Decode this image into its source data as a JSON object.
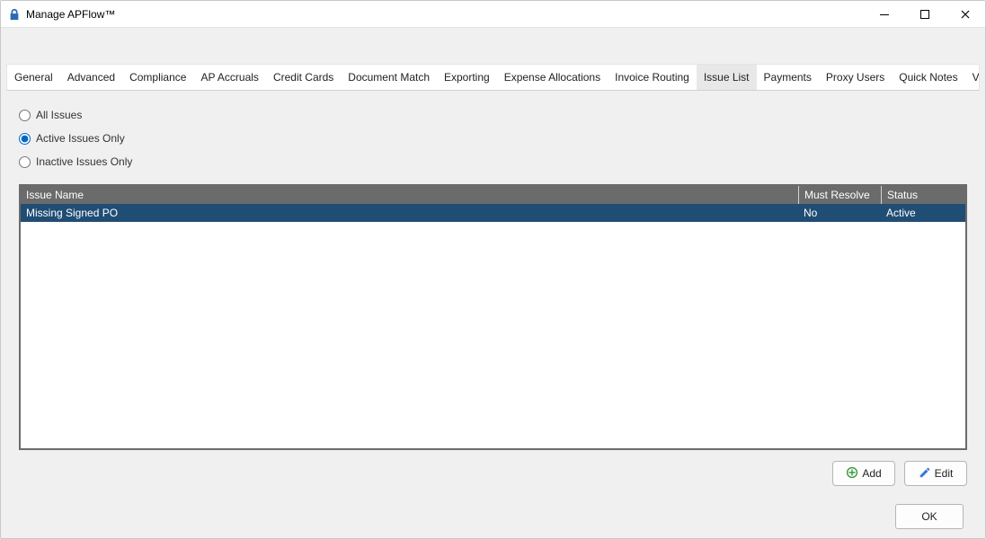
{
  "window": {
    "title": "Manage APFlow™"
  },
  "tabs": [
    {
      "label": "General"
    },
    {
      "label": "Advanced"
    },
    {
      "label": "Compliance"
    },
    {
      "label": "AP Accruals"
    },
    {
      "label": "Credit Cards"
    },
    {
      "label": "Document Match"
    },
    {
      "label": "Exporting"
    },
    {
      "label": "Expense Allocations"
    },
    {
      "label": "Invoice Routing"
    },
    {
      "label": "Issue List",
      "active": true
    },
    {
      "label": "Payments"
    },
    {
      "label": "Proxy Users"
    },
    {
      "label": "Quick Notes"
    },
    {
      "label": "Validation"
    }
  ],
  "filters": {
    "selected": "active",
    "all_label": "All Issues",
    "active_label": "Active Issues Only",
    "inactive_label": "Inactive Issues Only"
  },
  "grid": {
    "columns": {
      "name": "Issue Name",
      "resolve": "Must Resolve",
      "status": "Status"
    },
    "rows": [
      {
        "name": "Missing Signed PO",
        "resolve": "No",
        "status": "Active",
        "selected": true
      }
    ]
  },
  "buttons": {
    "add": "Add",
    "edit": "Edit",
    "ok": "OK"
  }
}
